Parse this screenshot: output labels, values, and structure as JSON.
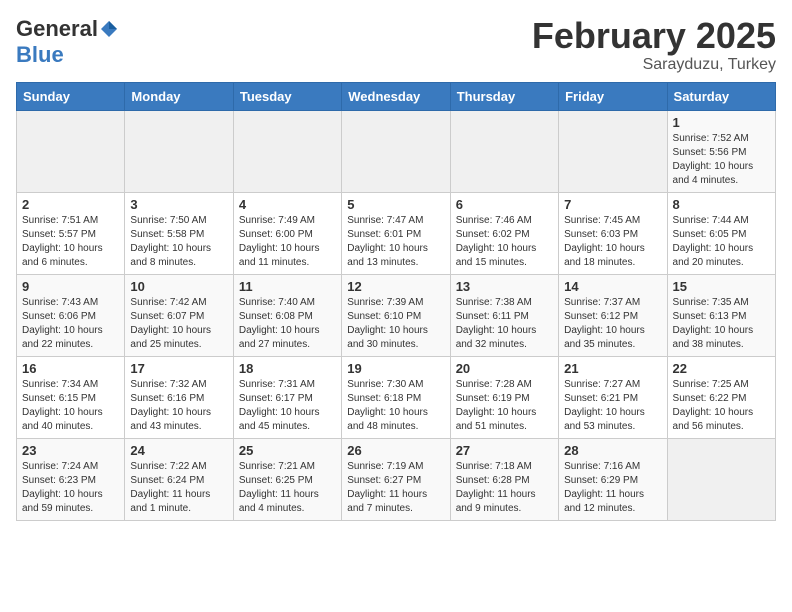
{
  "header": {
    "logo_general": "General",
    "logo_blue": "Blue",
    "month": "February 2025",
    "location": "Sarayduzu, Turkey"
  },
  "weekdays": [
    "Sunday",
    "Monday",
    "Tuesday",
    "Wednesday",
    "Thursday",
    "Friday",
    "Saturday"
  ],
  "weeks": [
    [
      {
        "day": "",
        "info": ""
      },
      {
        "day": "",
        "info": ""
      },
      {
        "day": "",
        "info": ""
      },
      {
        "day": "",
        "info": ""
      },
      {
        "day": "",
        "info": ""
      },
      {
        "day": "",
        "info": ""
      },
      {
        "day": "1",
        "info": "Sunrise: 7:52 AM\nSunset: 5:56 PM\nDaylight: 10 hours and 4 minutes."
      }
    ],
    [
      {
        "day": "2",
        "info": "Sunrise: 7:51 AM\nSunset: 5:57 PM\nDaylight: 10 hours and 6 minutes."
      },
      {
        "day": "3",
        "info": "Sunrise: 7:50 AM\nSunset: 5:58 PM\nDaylight: 10 hours and 8 minutes."
      },
      {
        "day": "4",
        "info": "Sunrise: 7:49 AM\nSunset: 6:00 PM\nDaylight: 10 hours and 11 minutes."
      },
      {
        "day": "5",
        "info": "Sunrise: 7:47 AM\nSunset: 6:01 PM\nDaylight: 10 hours and 13 minutes."
      },
      {
        "day": "6",
        "info": "Sunrise: 7:46 AM\nSunset: 6:02 PM\nDaylight: 10 hours and 15 minutes."
      },
      {
        "day": "7",
        "info": "Sunrise: 7:45 AM\nSunset: 6:03 PM\nDaylight: 10 hours and 18 minutes."
      },
      {
        "day": "8",
        "info": "Sunrise: 7:44 AM\nSunset: 6:05 PM\nDaylight: 10 hours and 20 minutes."
      }
    ],
    [
      {
        "day": "9",
        "info": "Sunrise: 7:43 AM\nSunset: 6:06 PM\nDaylight: 10 hours and 22 minutes."
      },
      {
        "day": "10",
        "info": "Sunrise: 7:42 AM\nSunset: 6:07 PM\nDaylight: 10 hours and 25 minutes."
      },
      {
        "day": "11",
        "info": "Sunrise: 7:40 AM\nSunset: 6:08 PM\nDaylight: 10 hours and 27 minutes."
      },
      {
        "day": "12",
        "info": "Sunrise: 7:39 AM\nSunset: 6:10 PM\nDaylight: 10 hours and 30 minutes."
      },
      {
        "day": "13",
        "info": "Sunrise: 7:38 AM\nSunset: 6:11 PM\nDaylight: 10 hours and 32 minutes."
      },
      {
        "day": "14",
        "info": "Sunrise: 7:37 AM\nSunset: 6:12 PM\nDaylight: 10 hours and 35 minutes."
      },
      {
        "day": "15",
        "info": "Sunrise: 7:35 AM\nSunset: 6:13 PM\nDaylight: 10 hours and 38 minutes."
      }
    ],
    [
      {
        "day": "16",
        "info": "Sunrise: 7:34 AM\nSunset: 6:15 PM\nDaylight: 10 hours and 40 minutes."
      },
      {
        "day": "17",
        "info": "Sunrise: 7:32 AM\nSunset: 6:16 PM\nDaylight: 10 hours and 43 minutes."
      },
      {
        "day": "18",
        "info": "Sunrise: 7:31 AM\nSunset: 6:17 PM\nDaylight: 10 hours and 45 minutes."
      },
      {
        "day": "19",
        "info": "Sunrise: 7:30 AM\nSunset: 6:18 PM\nDaylight: 10 hours and 48 minutes."
      },
      {
        "day": "20",
        "info": "Sunrise: 7:28 AM\nSunset: 6:19 PM\nDaylight: 10 hours and 51 minutes."
      },
      {
        "day": "21",
        "info": "Sunrise: 7:27 AM\nSunset: 6:21 PM\nDaylight: 10 hours and 53 minutes."
      },
      {
        "day": "22",
        "info": "Sunrise: 7:25 AM\nSunset: 6:22 PM\nDaylight: 10 hours and 56 minutes."
      }
    ],
    [
      {
        "day": "23",
        "info": "Sunrise: 7:24 AM\nSunset: 6:23 PM\nDaylight: 10 hours and 59 minutes."
      },
      {
        "day": "24",
        "info": "Sunrise: 7:22 AM\nSunset: 6:24 PM\nDaylight: 11 hours and 1 minute."
      },
      {
        "day": "25",
        "info": "Sunrise: 7:21 AM\nSunset: 6:25 PM\nDaylight: 11 hours and 4 minutes."
      },
      {
        "day": "26",
        "info": "Sunrise: 7:19 AM\nSunset: 6:27 PM\nDaylight: 11 hours and 7 minutes."
      },
      {
        "day": "27",
        "info": "Sunrise: 7:18 AM\nSunset: 6:28 PM\nDaylight: 11 hours and 9 minutes."
      },
      {
        "day": "28",
        "info": "Sunrise: 7:16 AM\nSunset: 6:29 PM\nDaylight: 11 hours and 12 minutes."
      },
      {
        "day": "",
        "info": ""
      }
    ]
  ]
}
